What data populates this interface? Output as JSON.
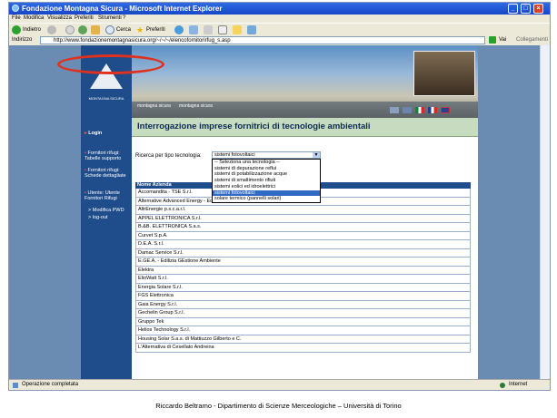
{
  "window": {
    "title": "Fondazione Montagna Sicura - Microsoft Internet Explorer",
    "controls": [
      "_",
      "□",
      "×"
    ]
  },
  "menu": [
    "File",
    "Modifica",
    "Visualizza",
    "Preferiti",
    "Strumenti",
    "?"
  ],
  "toolbar": {
    "back": "Indietro",
    "search": "Cerca",
    "favorites": "Preferiti"
  },
  "address": {
    "label": "Indirizzo",
    "url": "http://www.fondazionemontagnasicura.org/~/~/~/elencofornitorirfug_s.asp",
    "go": "Vai",
    "links": "Collegamenti"
  },
  "site": {
    "logo_text": "MONTAGNA SICURA",
    "nav": [
      "montagna sicura",
      "montagna sicura"
    ],
    "sidebar": [
      {
        "text": "Login",
        "bullet": "▸"
      },
      {
        "text": "Fornitori rifugi: Tabelle supporto",
        "bullet": "▪"
      },
      {
        "text": "Fornitori rifugi: Schede dettagliate",
        "bullet": "▪"
      },
      {
        "text": "Utente: Utente Fornitori Rifugi",
        "bullet": "▪"
      },
      {
        "text": "> Modifica PWD",
        "bullet": ""
      },
      {
        "text": "> log-out",
        "bullet": ""
      }
    ],
    "heading": "Interrogazione imprese fornitrici di tecnologie ambientali",
    "search_label": "Ricerca per tipo tecnologia:",
    "select_value": "sistemi fotovoltaici",
    "options": [
      "-- Seleziona una tecnologia --",
      "sistemi di depurazione reflui",
      "sistemi di potabilizzazione acque",
      "sistemi di smaltimento rifiuti",
      "sistemi eolici ed idroelettrici",
      "sistemi fotovoltaici",
      "solare termico (pannelli solari)"
    ],
    "selected_option_index": 5,
    "table_header": "Nome Azienda",
    "companies": [
      "Accomandita - TSE S.r.l.",
      "Alternative Advanced Energy - Edison",
      "AltrEnergie p.s.c.a.r.l.",
      "APPEL ELETTRONICA S.r.l.",
      "B.&B. ELETTRONICA S.a.s.",
      "Curvet S.p.A.",
      "D.E.A. S.r.l.",
      "Damac Service S.r.l.",
      "E.GE.A. - Edilizia GEstione Ambiente",
      "Elektra",
      "ElioWatt S.r.l.",
      "Energia Solare S.r.l.",
      "FGS Elettronica",
      "Gaia Energy S.r.l.",
      "Gechelin Group S.r.l.",
      "Gruppo Tek",
      "Helios Technology S.r.l.",
      "Housing Solar S.a.s. di Mattiuzzo Gilberto e C.",
      "L'Alternativa di Cesellato Andreina"
    ]
  },
  "status": {
    "left": "Operazione completata",
    "right": "Internet"
  },
  "footer": "Riccardo Beltramo - Dipartimento di Scienze Merceologiche – Università di Torino",
  "colors": {
    "accent_navy": "#1f4c8a",
    "heading_bg": "#c7dbc0",
    "highlight_ellipse": "#e0301e",
    "selection": "#316ac5"
  }
}
